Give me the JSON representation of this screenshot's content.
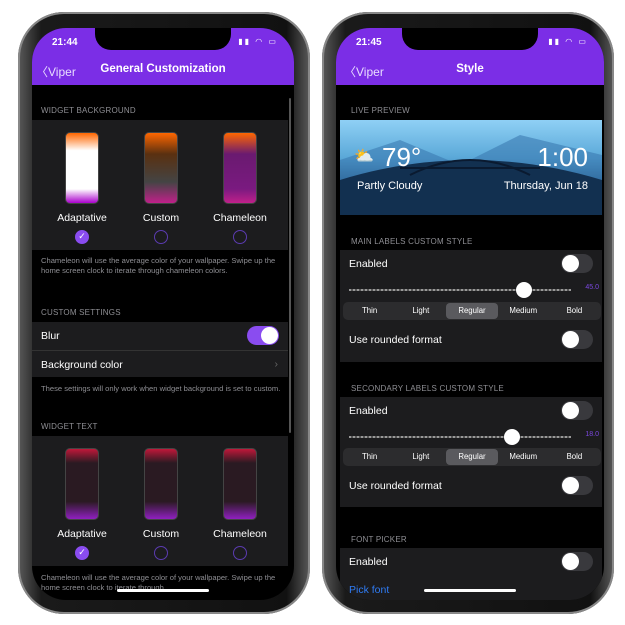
{
  "left": {
    "status_time": "21:44",
    "back_label": "Viper",
    "title": "General Customization",
    "widget_background": {
      "header": "WIDGET BACKGROUND",
      "options": [
        {
          "label": "Adaptative",
          "selected": true
        },
        {
          "label": "Custom",
          "selected": false
        },
        {
          "label": "Chameleon",
          "selected": false
        }
      ],
      "footnote": "Chameleon will use the average color of your wallpaper. Swipe up the home screen clock to iterate through chameleon colors."
    },
    "custom_settings": {
      "header": "CUSTOM SETTINGS",
      "blur_label": "Blur",
      "blur_on": true,
      "bg_color_label": "Background color",
      "footnote": "These settings will only work when widget background is set to custom."
    },
    "widget_text": {
      "header": "WIDGET TEXT",
      "options": [
        {
          "label": "Adaptative",
          "selected": true
        },
        {
          "label": "Custom",
          "selected": false
        },
        {
          "label": "Chameleon",
          "selected": false
        }
      ],
      "footnote": "Chameleon will use the average color of your wallpaper. Swipe up the home screen clock to iterate through"
    }
  },
  "right": {
    "status_time": "21:45",
    "back_label": "Viper",
    "title": "Style",
    "live_preview": {
      "header": "LIVE PREVIEW",
      "temp": "79°",
      "condition": "Partly Cloudy",
      "clock": "1:00",
      "date": "Thursday, Jun 18"
    },
    "main_labels": {
      "header": "MAIN LABELS CUSTOM STYLE",
      "enabled_label": "Enabled",
      "enabled": false,
      "size": "45.0",
      "size_fraction": 0.75,
      "weights": [
        "Thin",
        "Light",
        "Regular",
        "Medium",
        "Bold"
      ],
      "selected_weight": "Regular",
      "rounded_label": "Use rounded format",
      "rounded": false
    },
    "secondary_labels": {
      "header": "SECONDARY LABELS CUSTOM STYLE",
      "enabled_label": "Enabled",
      "enabled": false,
      "size": "18.0",
      "size_fraction": 0.7,
      "weights": [
        "Thin",
        "Light",
        "Regular",
        "Medium",
        "Bold"
      ],
      "selected_weight": "Regular",
      "rounded_label": "Use rounded format",
      "rounded": false
    },
    "font_picker": {
      "header": "FONT PICKER",
      "enabled_label": "Enabled",
      "enabled": false,
      "pick_label": "Pick font"
    }
  },
  "colors": {
    "accent": "#7b2ee6",
    "link": "#2f7cf6"
  }
}
